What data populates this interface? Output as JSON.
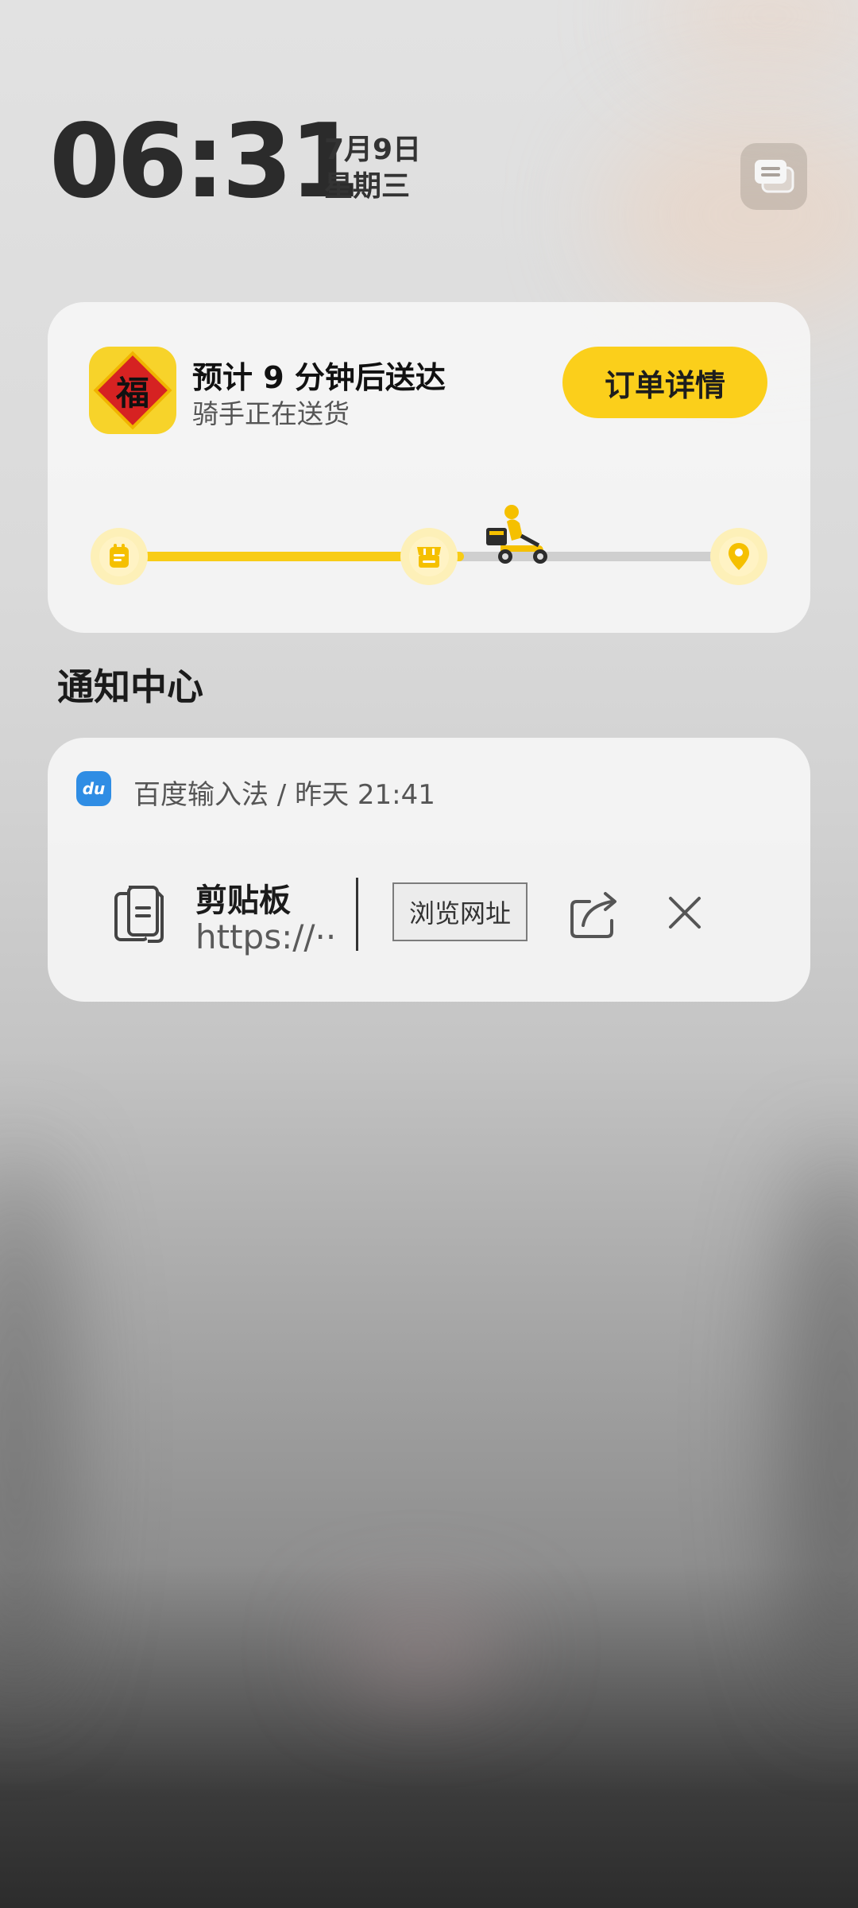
{
  "lockscreen": {
    "time": "06:31",
    "date": "7月9日",
    "weekday": "星期三"
  },
  "delivery": {
    "title": "预计 9 分钟后送达",
    "subtitle": "骑手正在送货",
    "button_label": "订单详情",
    "app_icon_glyph": "福",
    "progress": 0.55,
    "colors": {
      "accent": "#F8CC16",
      "track": "#CFCFCF"
    }
  },
  "notification_center": {
    "title": "通知中心",
    "notification": {
      "app_icon_text": "du",
      "header": "百度输入法 / 昨天 21:41",
      "clip_title": "剪贴板",
      "clip_url": "https://··",
      "action_label": "浏览网址"
    }
  }
}
